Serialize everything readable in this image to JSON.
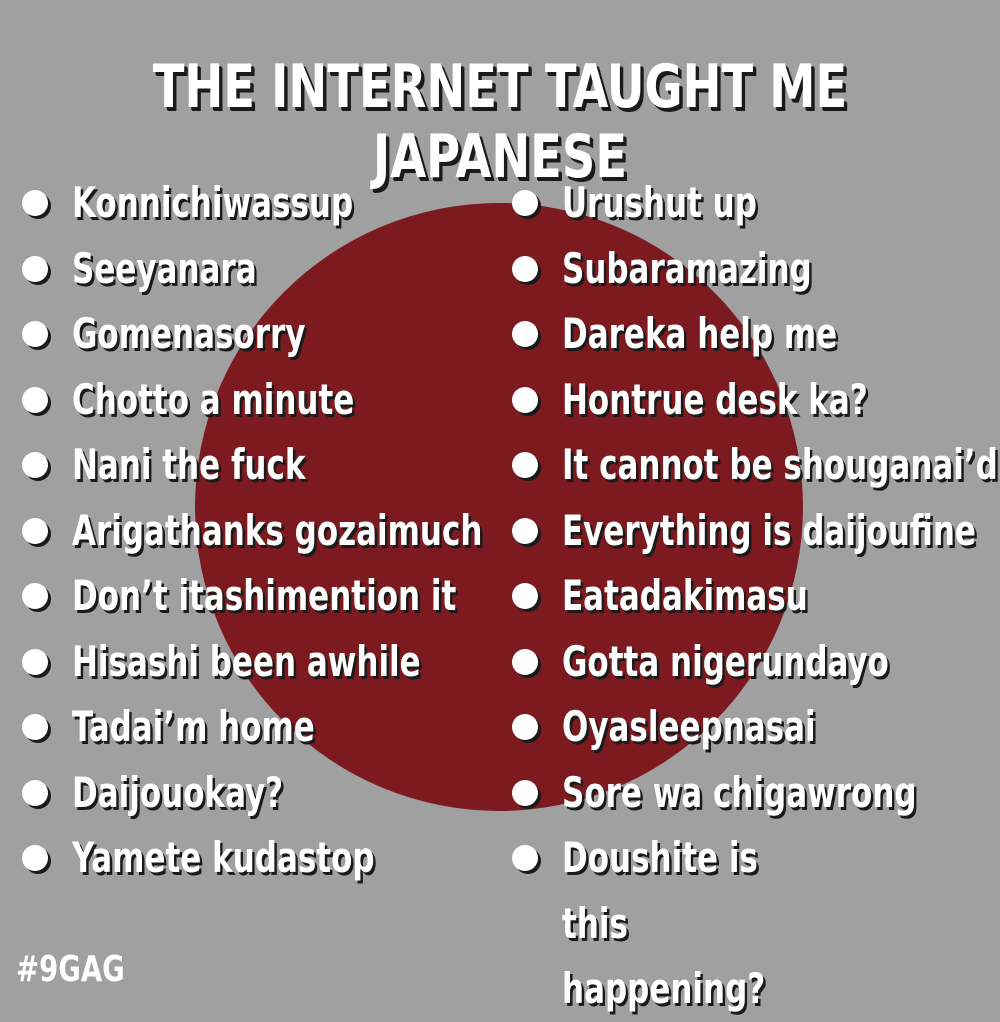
{
  "title": "THE INTERNET TAUGHT ME JAPANESE",
  "watermark": "#9GAG",
  "colors": {
    "background": "#a0a0a0",
    "sun": "#7c1a1f",
    "text": "#ffffff",
    "shadow": "#1a1a1a"
  },
  "left_column": [
    "Konnichiwassup",
    "Seeyanara",
    "Gomenasorry",
    "Chotto a minute",
    "Nani the fuck",
    "Arigathanks gozaimuch",
    "Don’t itashimention it",
    "Hisashi been awhile",
    "Tadai’m home",
    "Daijouokay?",
    "Yamete kudastop"
  ],
  "right_column": [
    "Urushut up",
    "Subaramazing",
    "Dareka help me",
    "Hontrue desk ka?",
    "It cannot be shouganai’d",
    "Everything is daijoufine",
    "Eatadakimasu",
    "Gotta nigerundayo",
    "Oyasleepnasai",
    "Sore wa chigawrong",
    "Doushite is this happening?"
  ]
}
